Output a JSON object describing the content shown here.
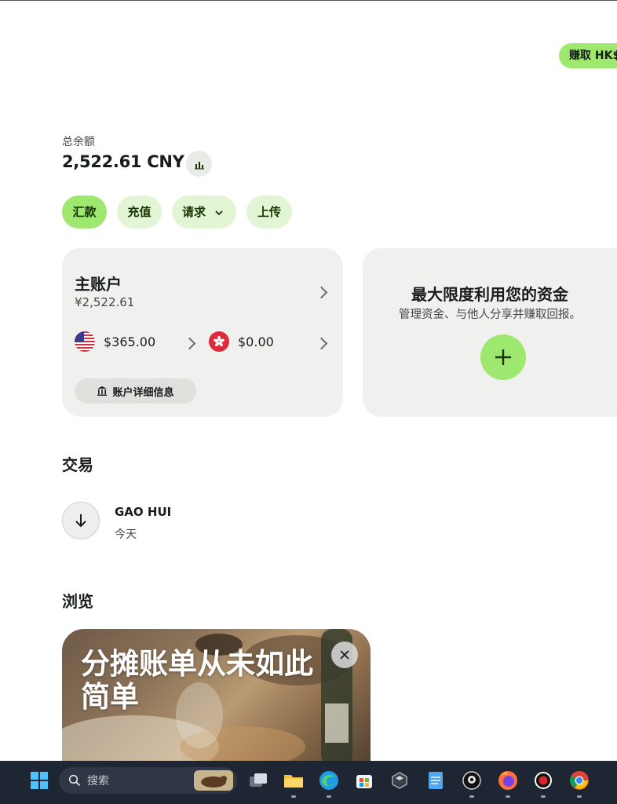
{
  "header": {
    "earn_label": "赚取 HK$"
  },
  "balance": {
    "label": "总余额",
    "amount": "2,522.61 CNY"
  },
  "actions": [
    {
      "label": "汇款"
    },
    {
      "label": "充值"
    },
    {
      "label": "请求"
    },
    {
      "label": "上传"
    }
  ],
  "main_account": {
    "title": "主账户",
    "amount": "¥2,522.61",
    "currencies": [
      {
        "amount": "$365.00",
        "flag": "us-flag-icon"
      },
      {
        "amount": "$0.00",
        "flag": "hk-flag-icon"
      }
    ],
    "details_label": "账户详细信息"
  },
  "promo": {
    "title": "最大限度利用您的资金",
    "subtitle": "管理资金、与他人分享并赚取回报。"
  },
  "transactions": {
    "title": "交易",
    "items": [
      {
        "name": "GAO HUI",
        "date": "今天",
        "icon": "arrow-down-icon"
      }
    ]
  },
  "browse": {
    "title": "浏览",
    "card_title": "分摊账单从未如此简单"
  },
  "taskbar": {
    "search_placeholder": "搜索"
  },
  "colors": {
    "accent": "#9fe870",
    "accent_light": "#e2f6d5",
    "text": "#191c1f",
    "card": "#f0f1ee",
    "taskbar": "#1e2633"
  }
}
